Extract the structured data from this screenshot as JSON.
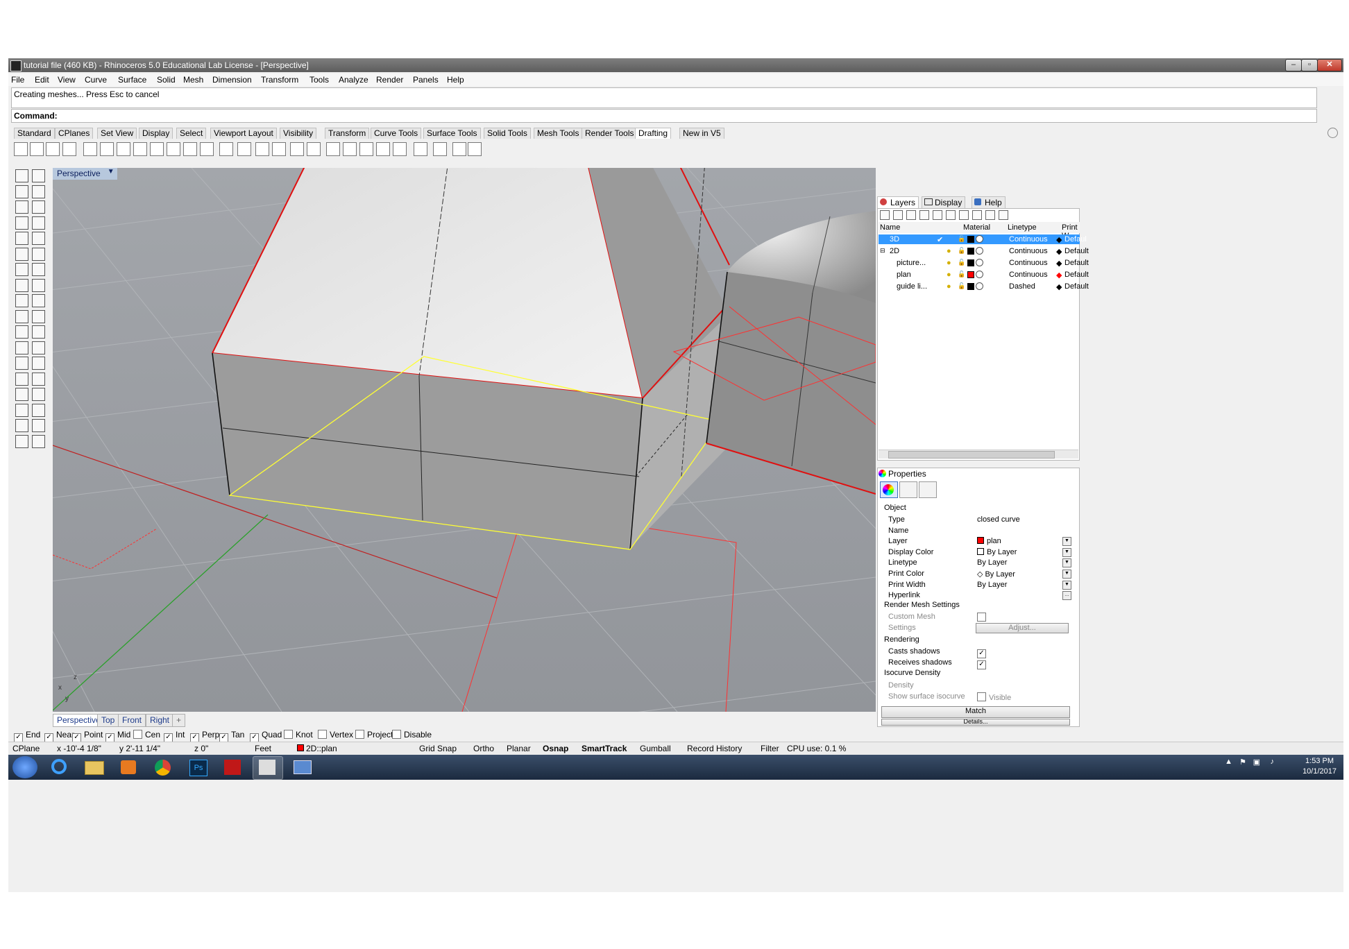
{
  "window": {
    "title": "tutorial file (460 KB) - Rhinoceros 5.0 Educational Lab License - [Perspective]"
  },
  "menu": [
    "File",
    "Edit",
    "View",
    "Curve",
    "Surface",
    "Solid",
    "Mesh",
    "Dimension",
    "Transform",
    "Tools",
    "Analyze",
    "Render",
    "Panels",
    "Help"
  ],
  "command_history": "Creating meshes... Press Esc to cancel",
  "command_prompt": "Command:",
  "toolbar_tabs": [
    "Standard",
    "CPlanes",
    "Set View",
    "Display",
    "Select",
    "Viewport Layout",
    "Visibility",
    "Transform",
    "Curve Tools",
    "Surface Tools",
    "Solid Tools",
    "Mesh Tools",
    "Render Tools",
    "Drafting",
    "New in V5"
  ],
  "active_toolbar_tab": "Drafting",
  "viewport": {
    "label": "Perspective",
    "axis_labels": {
      "z": "z",
      "x": "x",
      "y": "y"
    }
  },
  "view_tabs": [
    "Perspective",
    "Top",
    "Front",
    "Right"
  ],
  "osnaps": [
    {
      "label": "End",
      "checked": true
    },
    {
      "label": "Near",
      "checked": true
    },
    {
      "label": "Point",
      "checked": true
    },
    {
      "label": "Mid",
      "checked": true
    },
    {
      "label": "Cen",
      "checked": false
    },
    {
      "label": "Int",
      "checked": true
    },
    {
      "label": "Perp",
      "checked": true
    },
    {
      "label": "Tan",
      "checked": true
    },
    {
      "label": "Quad",
      "checked": true
    },
    {
      "label": "Knot",
      "checked": false
    },
    {
      "label": "Vertex",
      "checked": false
    },
    {
      "label": "Project",
      "checked": false
    },
    {
      "label": "Disable",
      "checked": false
    }
  ],
  "status": {
    "cplane": "CPlane",
    "x": "x -10'-4 1/8\"",
    "y": "y 2'-11 1/4\"",
    "z": "z 0\"",
    "units": "Feet",
    "layer": "2D::plan",
    "toggles": [
      "Grid Snap",
      "Ortho",
      "Planar",
      "Osnap",
      "SmartTrack",
      "Gumball",
      "Record History",
      "Filter"
    ],
    "cpu": "CPU use: 0.1 %"
  },
  "panels": {
    "tabs": [
      "Layers",
      "Display",
      "Help"
    ],
    "layers": {
      "columns": [
        "Name",
        "Material",
        "Linetype",
        "Print W"
      ],
      "rows": [
        {
          "name": "3D",
          "linetype": "Continuous",
          "print": "Defaul",
          "color": "#000000",
          "selected": true
        },
        {
          "name": "2D",
          "linetype": "Continuous",
          "print": "Default",
          "color": "#000000"
        },
        {
          "name": "picture...",
          "linetype": "Continuous",
          "print": "Default",
          "color": "#000000"
        },
        {
          "name": "plan",
          "linetype": "Continuous",
          "print": "Default",
          "color": "#ff0000"
        },
        {
          "name": "guide li...",
          "linetype": "Dashed",
          "print": "Default",
          "color": "#000000"
        }
      ]
    },
    "properties": {
      "title": "Properties",
      "object_section": "Object",
      "rows": [
        {
          "k": "Type",
          "v": "closed curve"
        },
        {
          "k": "Name",
          "v": ""
        },
        {
          "k": "Layer",
          "v": "plan"
        },
        {
          "k": "Display Color",
          "v": "By Layer"
        },
        {
          "k": "Linetype",
          "v": "By Layer"
        },
        {
          "k": "Print Color",
          "v": "By Layer"
        },
        {
          "k": "Print Width",
          "v": "By Layer"
        },
        {
          "k": "Hyperlink",
          "v": ""
        }
      ],
      "render_mesh_section": "Render Mesh Settings",
      "custom_mesh": "Custom Mesh",
      "settings": "Settings",
      "adjust": "Adjust...",
      "rendering_section": "Rendering",
      "casts": "Casts shadows",
      "receives": "Receives shadows",
      "isocurve_section": "Isocurve Density",
      "density": "Density",
      "show_iso": "Show surface isocurve",
      "visible": "Visible",
      "match": "Match",
      "details": "Details..."
    }
  },
  "clock": {
    "time": "1:53 PM",
    "date": "10/1/2017"
  },
  "colors": {
    "accent": "#3399ff",
    "selection_curve": "#ffff33",
    "edge_red": "#ff0000"
  }
}
